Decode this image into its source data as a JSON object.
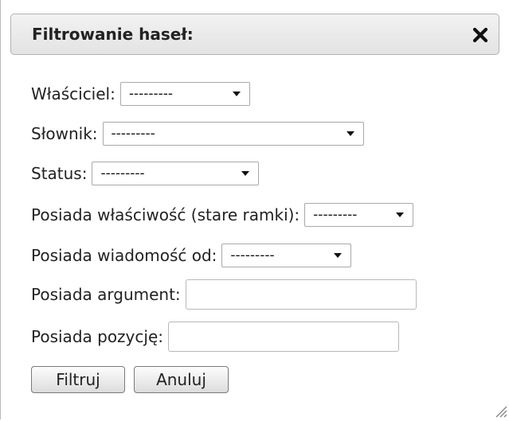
{
  "dialog": {
    "title": "Filtrowanie haseł:",
    "close_icon": "close-icon"
  },
  "filters": {
    "owner": {
      "label": "Właściciel:",
      "value": "---------"
    },
    "dictionary": {
      "label": "Słownik:",
      "value": "---------"
    },
    "status": {
      "label": "Status:",
      "value": "---------"
    },
    "property": {
      "label": "Posiada właściwość (stare ramki):",
      "value": "---------"
    },
    "message_from": {
      "label": "Posiada wiadomość od:",
      "value": "---------"
    },
    "argument": {
      "label": "Posiada argument:",
      "value": ""
    },
    "position": {
      "label": "Posiada pozycję:",
      "value": ""
    }
  },
  "buttons": {
    "filter": "Filtruj",
    "cancel": "Anuluj"
  }
}
